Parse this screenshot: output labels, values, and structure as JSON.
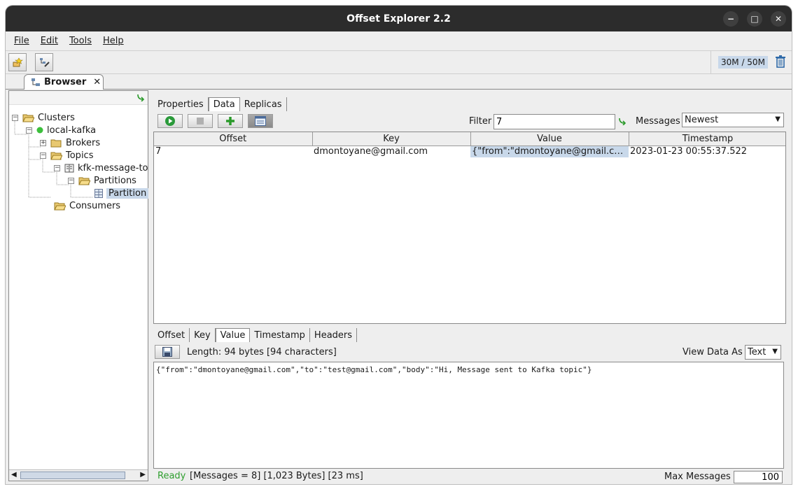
{
  "window": {
    "title": "Offset Explorer  2.2"
  },
  "menu": [
    "File",
    "Edit",
    "Tools",
    "Help"
  ],
  "memory": {
    "used": "30M",
    "total": "50M",
    "separator": " / "
  },
  "doc_tab": {
    "label": "Browser"
  },
  "tree": {
    "clusters": "Clusters",
    "cluster": "local-kafka",
    "brokers": "Brokers",
    "topics": "Topics",
    "topic": "kfk-message-to",
    "partitions": "Partitions",
    "partition": "Partition",
    "consumers": "Consumers"
  },
  "subtabs": [
    "Properties",
    "Data",
    "Replicas"
  ],
  "filter": {
    "label": "Filter",
    "value": "7"
  },
  "messages": {
    "label": "Messages",
    "selected": "Newest"
  },
  "table": {
    "columns": [
      "Offset",
      "Key",
      "Value",
      "Timestamp"
    ],
    "rows": [
      [
        "7",
        "dmontoyane@gmail.com",
        "{\"from\":\"dmontoyane@gmail.com...",
        "2023-01-23 00:55:37.522"
      ]
    ]
  },
  "detail_tabs": [
    "Offset",
    "Key",
    "Value",
    "Timestamp",
    "Headers"
  ],
  "detail": {
    "length": "Length: 94 bytes [94 characters]",
    "view_as_label": "View Data As",
    "view_as_value": "Text",
    "content": "{\"from\":\"dmontoyane@gmail.com\",\"to\":\"test@gmail.com\",\"body\":\"Hi, Message sent to Kafka topic\"}"
  },
  "status": {
    "ready": "Ready",
    "text": "[Messages = 8]  [1,023 Bytes]  [23 ms]",
    "max_label": "Max Messages",
    "max_value": "100"
  },
  "colors": {
    "title_bar": "#2c2c2c",
    "selection": "#c8d8ea",
    "ready": "#2e9e2e"
  },
  "icons": [
    "minimize-icon",
    "maximize-icon",
    "close-icon",
    "new-connection-icon",
    "edit-icon",
    "trash-icon",
    "refresh-icon",
    "folder-icon",
    "connected-icon",
    "topic-icon",
    "partition-icon",
    "play-icon",
    "stop-icon",
    "add-icon",
    "decode-icon",
    "save-icon"
  ]
}
